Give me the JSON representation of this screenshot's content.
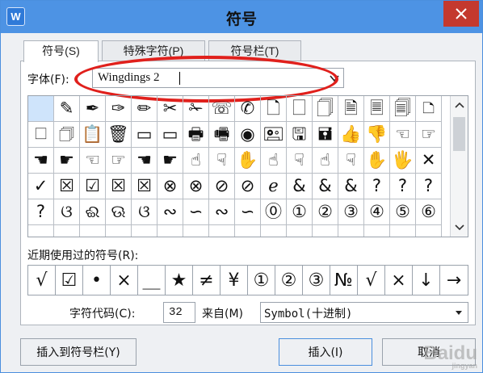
{
  "window": {
    "app_icon_letter": "W",
    "title": "符号"
  },
  "tabs": [
    {
      "label": "符号(S)",
      "active": true
    },
    {
      "label": "特殊字符(P)",
      "active": false
    },
    {
      "label": "符号栏(T)",
      "active": false
    }
  ],
  "font": {
    "label": "字体(F):",
    "value": "Wingdings 2"
  },
  "symbol_grid": {
    "rows": [
      [
        "",
        "✎",
        "✒",
        "✑",
        "✏",
        "✂",
        "✁",
        "☏",
        "✆",
        "🗋",
        "🗌",
        "🗍",
        "🗎",
        "🗏",
        "🗐",
        "🗅"
      ],
      [
        "🗆",
        "🗇",
        "📋",
        "🗑",
        "▭",
        "▭",
        "🖶",
        "🖷",
        "◉",
        "🖭",
        "🖫",
        "🖬",
        "👍",
        "👎",
        "☜",
        "☞"
      ],
      [
        "☚",
        "☛",
        "☜",
        "☞",
        "☚",
        "☛",
        "☝",
        "☟",
        "✋",
        "☝",
        "☟",
        "☝",
        "☟",
        "✋",
        "🖐",
        "✕"
      ],
      [
        "✓",
        "☒",
        "☑",
        "☒",
        "☒",
        "⊗",
        "⊗",
        "⊘",
        "⊘",
        "ℯ",
        "&",
        "&",
        "&",
        "?",
        "?",
        "?"
      ],
      [
        "?",
        "ଓ",
        "ଈ",
        "ଊ",
        "ଓ",
        "∾",
        "∽",
        "∾",
        "∽",
        "⓪",
        "①",
        "②",
        "③",
        "④",
        "⑤",
        "⑥"
      ],
      [
        "",
        "",
        "",
        "",
        "",
        "",
        "",
        "",
        "",
        "",
        "",
        "",
        "",
        "",
        "",
        ""
      ]
    ]
  },
  "recent": {
    "label": "近期使用过的符号(R):",
    "symbols": [
      "√",
      "☑",
      "•",
      "×",
      "＿",
      "★",
      "≠",
      "¥",
      "①",
      "②",
      "③",
      "№",
      "√",
      "×",
      "↓",
      "→"
    ]
  },
  "char_code": {
    "label": "字符代码(C):",
    "value": "32"
  },
  "from": {
    "label": "来自(M)",
    "value": "Symbol(十进制)"
  },
  "buttons": {
    "insert_to_toolbar": "插入到符号栏(Y)",
    "insert": "插入(I)",
    "cancel": "取消"
  },
  "watermark": {
    "text": "Baidu",
    "sub": "jingyan"
  },
  "colors": {
    "titlebar": "#4d93e4",
    "close": "#c4392e",
    "highlight_ellipse": "#e0201c",
    "selected_cell": "#cfe4fb"
  }
}
